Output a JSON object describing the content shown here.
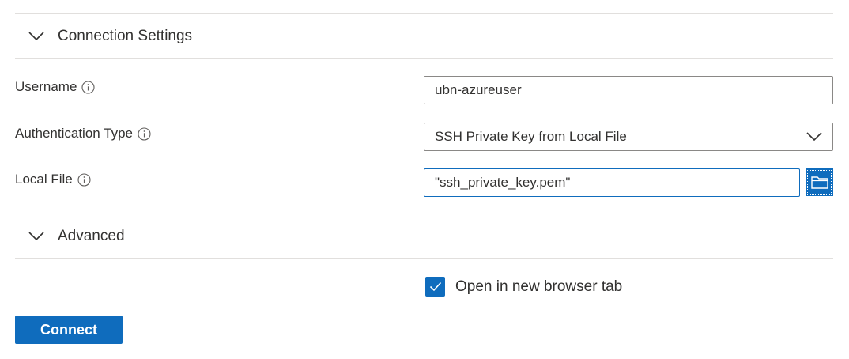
{
  "sections": {
    "connection": {
      "title": "Connection Settings",
      "expanded": true
    },
    "advanced": {
      "title": "Advanced",
      "expanded": true
    }
  },
  "fields": {
    "username": {
      "label": "Username",
      "value": "ubn-azureuser",
      "info_icon": "info-icon"
    },
    "auth_type": {
      "label": "Authentication Type",
      "selected": "SSH Private Key from Local File",
      "info_icon": "info-icon"
    },
    "local_file": {
      "label": "Local File",
      "value": "\"ssh_private_key.pem\"",
      "info_icon": "info-icon",
      "browse_icon": "folder-icon"
    }
  },
  "options": {
    "open_new_tab": {
      "label": "Open in new browser tab",
      "checked": true
    }
  },
  "actions": {
    "connect_label": "Connect"
  },
  "colors": {
    "accent": "#0f6cbd",
    "divider": "#e1dfdd",
    "text": "#323130",
    "input_border": "#8a8886"
  }
}
